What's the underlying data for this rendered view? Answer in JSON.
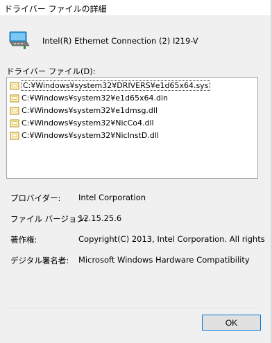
{
  "window": {
    "title": "ドライバー ファイルの詳細"
  },
  "device": {
    "name": "Intel(R) Ethernet Connection (2) I219-V",
    "icon": "network-adapter-icon"
  },
  "files": {
    "label": "ドライバー ファイル(D):",
    "items": [
      {
        "path": "C:¥Windows¥system32¥DRIVERS¥e1d65x64.sys",
        "selected": true
      },
      {
        "path": "C:¥Windows¥system32¥e1d65x64.din",
        "selected": false
      },
      {
        "path": "C:¥Windows¥system32¥e1dmsg.dll",
        "selected": false
      },
      {
        "path": "C:¥Windows¥system32¥NicCo4.dll",
        "selected": false
      },
      {
        "path": "C:¥Windows¥system32¥NicInstD.dll",
        "selected": false
      }
    ]
  },
  "properties": {
    "provider_label": "プロバイダー:",
    "provider_value": "Intel Corporation",
    "version_label": "ファイル バージョン:",
    "version_value": "12.15.25.6",
    "copyright_label": "著作権:",
    "copyright_value": "Copyright(C) 2013, Intel Corporation.  All rights",
    "signer_label": "デジタル署名者:",
    "signer_value": "Microsoft Windows Hardware Compatibility"
  },
  "buttons": {
    "ok_label": "OK"
  },
  "colors": {
    "accent": "#0078d7",
    "background": "#f0f0f0"
  }
}
